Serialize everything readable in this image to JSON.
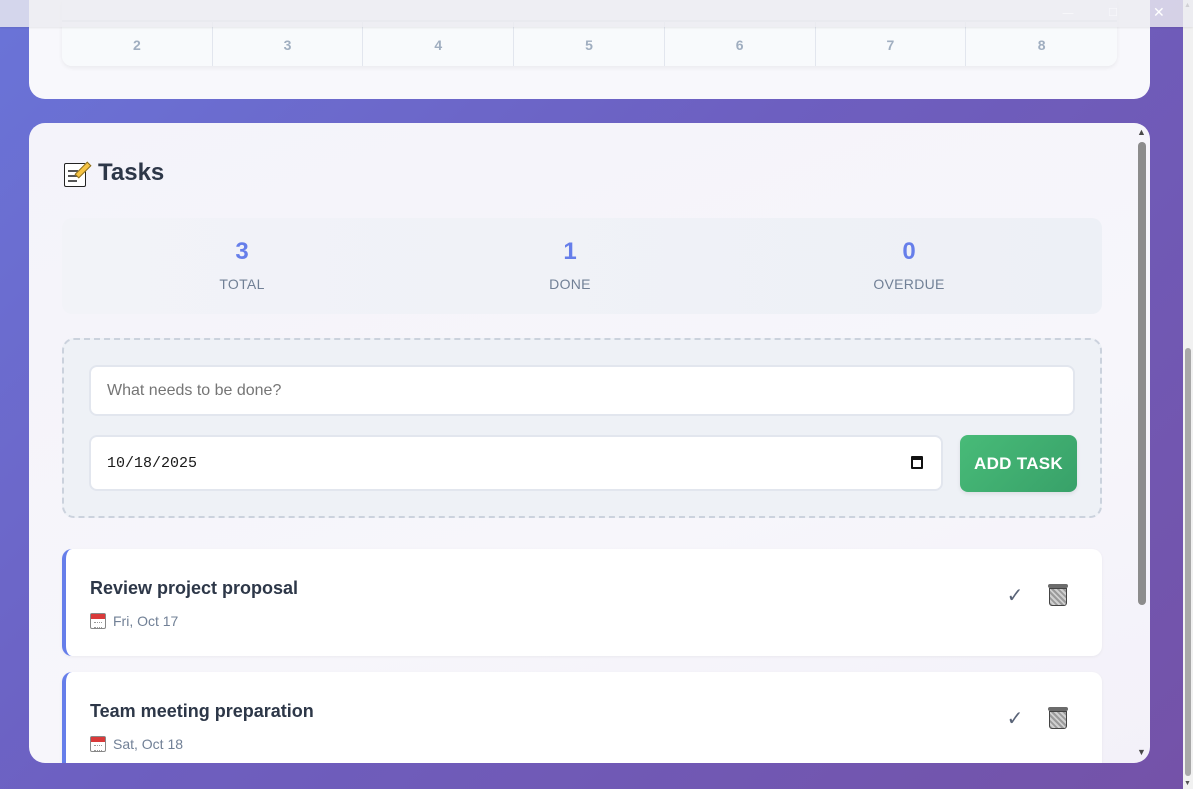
{
  "window": {
    "minimize_glyph": "—",
    "maximize_glyph": "☐",
    "close_glyph": "✕"
  },
  "calendar": {
    "last_row_days": [
      "2",
      "3",
      "4",
      "5",
      "6",
      "7",
      "8"
    ]
  },
  "tasks_section": {
    "title": "Tasks",
    "stats": [
      {
        "value": "3",
        "label": "TOTAL"
      },
      {
        "value": "1",
        "label": "DONE"
      },
      {
        "value": "0",
        "label": "OVERDUE"
      }
    ],
    "form": {
      "task_placeholder": "What needs to be done?",
      "task_value": "",
      "date_value": "10/18/2025",
      "add_button_label": "ADD TASK"
    },
    "items": [
      {
        "title": "Review project proposal",
        "date": "Fri, Oct 17",
        "complete_glyph": "✓"
      },
      {
        "title": "Team meeting preparation",
        "date": "Sat, Oct 18",
        "complete_glyph": "✓"
      }
    ]
  },
  "icons": {
    "header": "memo-icon",
    "task_date": "calendar-icon",
    "complete": "checkmark-icon",
    "delete": "wastebasket-icon",
    "date_picker": "calendar-picker-icon"
  },
  "colors": {
    "accent": "#667eea",
    "add_button": "#48bb78",
    "text_primary": "#2d3748",
    "text_muted": "#718096"
  }
}
